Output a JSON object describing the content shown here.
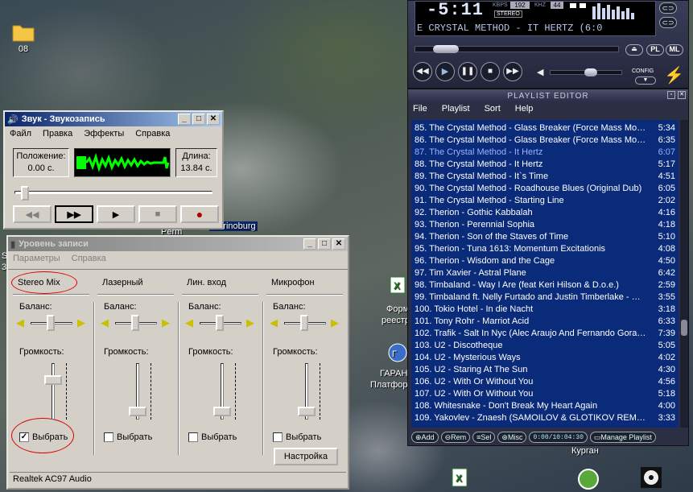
{
  "desktop": {
    "folder_label": "08",
    "partial_labels": {
      "perm": "Perm",
      "ekaterinburg": "aterinoburg",
      "form": "Форм",
      "reestr": "реестра",
      "garan": "ГАРАН",
      "platforma": "Платфор",
      "kurgan": "Курган",
      "s": "S",
      "three": "3"
    }
  },
  "recorder": {
    "title": "Звук - Звукозапись",
    "menu": [
      "Файл",
      "Правка",
      "Эффекты",
      "Справка"
    ],
    "position_label": "Положение:",
    "position_value": "0.00 с.",
    "length_label": "Длина:",
    "length_value": "13.84 с.",
    "wave_color": "#00ff00",
    "controls": [
      "rewind",
      "fast-forward",
      "play",
      "stop",
      "record"
    ]
  },
  "mixer": {
    "title": "Уровень записи",
    "menu": [
      "Параметры",
      "Справка"
    ],
    "balance_label": "Баланс:",
    "volume_label": "Громкость:",
    "select_label": "Выбрать",
    "channels": [
      {
        "name": "Stereo Mix",
        "selected": true,
        "volume_level": 0.7
      },
      {
        "name": "Лазерный",
        "selected": false,
        "volume_level": 0.15
      },
      {
        "name": "Лин. вход",
        "selected": false,
        "volume_level": 0.15
      },
      {
        "name": "Микрофон",
        "selected": false,
        "volume_level": 0.15
      }
    ],
    "advanced_button": "Настройка",
    "status": "Realtek AC97 Audio",
    "highlight_color": "#e00000"
  },
  "winamp": {
    "time": "-5:11",
    "kbps_label": "KBPS",
    "kbps": "192",
    "khz_label": "KHZ",
    "khz": "44",
    "stereo": "STEREO",
    "marquee": "E CRYSTAL METHOD - IT HERTZ (6:0",
    "buttons": {
      "pl": "PL",
      "ml": "ML",
      "config": "CONFIG"
    }
  },
  "playlist": {
    "title": "PLAYLIST EDITOR",
    "menu": [
      "File",
      "Playlist",
      "Sort",
      "Help"
    ],
    "items": [
      {
        "title": "85. The Crystal Method - Glass Breaker (Force Mass Moti...",
        "duration": "5:34",
        "current": false
      },
      {
        "title": "86. The Crystal Method - Glass Breaker (Force Mass Moti...",
        "duration": "6:35",
        "current": false
      },
      {
        "title": "87. The Crystal Method - It Hertz",
        "duration": "6:07",
        "current": true
      },
      {
        "title": "88. The Crystal Method - It Hertz",
        "duration": "5:17",
        "current": false
      },
      {
        "title": "89. The Crystal Method - It`s Time",
        "duration": "4:51",
        "current": false
      },
      {
        "title": "90. The Crystal Method - Roadhouse Blues (Original Dub)",
        "duration": "6:05",
        "current": false
      },
      {
        "title": "91. The Crystal Method - Starting Line",
        "duration": "2:02",
        "current": false
      },
      {
        "title": "92. Therion - Gothic Kabbalah",
        "duration": "4:16",
        "current": false
      },
      {
        "title": "93. Therion - Perennial Sophia",
        "duration": "4:18",
        "current": false
      },
      {
        "title": "94. Therion - Son of the Staves of Time",
        "duration": "5:10",
        "current": false
      },
      {
        "title": "95. Therion - Tuna 1613: Momentum Excitationis",
        "duration": "4:08",
        "current": false
      },
      {
        "title": "96. Therion - Wisdom and the Cage",
        "duration": "4:50",
        "current": false
      },
      {
        "title": "97. Tim Xavier - Astral Plane",
        "duration": "6:42",
        "current": false
      },
      {
        "title": "98. Timbaland - Way I Are (feat Keri Hilson & D.o.e.)",
        "duration": "2:59",
        "current": false
      },
      {
        "title": "99. Timbaland ft. Nelly Furtado and Justin Timberlake - Giv...",
        "duration": "3:55",
        "current": false
      },
      {
        "title": "100. Tokio Hotel - In die Nacht",
        "duration": "3:18",
        "current": false
      },
      {
        "title": "101. Tony Rohr - Marriot Acid",
        "duration": "6:33",
        "current": false
      },
      {
        "title": "102. Trafik - Salt In Nyc (Alec Araujo And Fernando Goraie...",
        "duration": "7:39",
        "current": false
      },
      {
        "title": "103. U2 - Discotheque",
        "duration": "5:05",
        "current": false
      },
      {
        "title": "104. U2 - Mysterious Ways",
        "duration": "4:02",
        "current": false
      },
      {
        "title": "105. U2 - Staring At The Sun",
        "duration": "4:30",
        "current": false
      },
      {
        "title": "106. U2 - With Or Without You",
        "duration": "4:56",
        "current": false
      },
      {
        "title": "107. U2 - With Or Without You",
        "duration": "5:18",
        "current": false
      },
      {
        "title": "108. Whitesnake - Don't Break My Heart Again",
        "duration": "4:00",
        "current": false
      },
      {
        "title": "109. Yakovlev - Znaesh (SAMOILOV & GLOTIKOV REMIX)",
        "duration": "3:33",
        "current": false
      }
    ],
    "buttons": {
      "add": "Add",
      "rem": "Rem",
      "sel": "Sel",
      "misc": "Misc",
      "manage": "Manage Playlist"
    },
    "time_readout": "0:00/10:04:30",
    "colors": {
      "bg": "#0a2a7a",
      "text": "#ffffff",
      "current": "#99b4ff"
    }
  }
}
